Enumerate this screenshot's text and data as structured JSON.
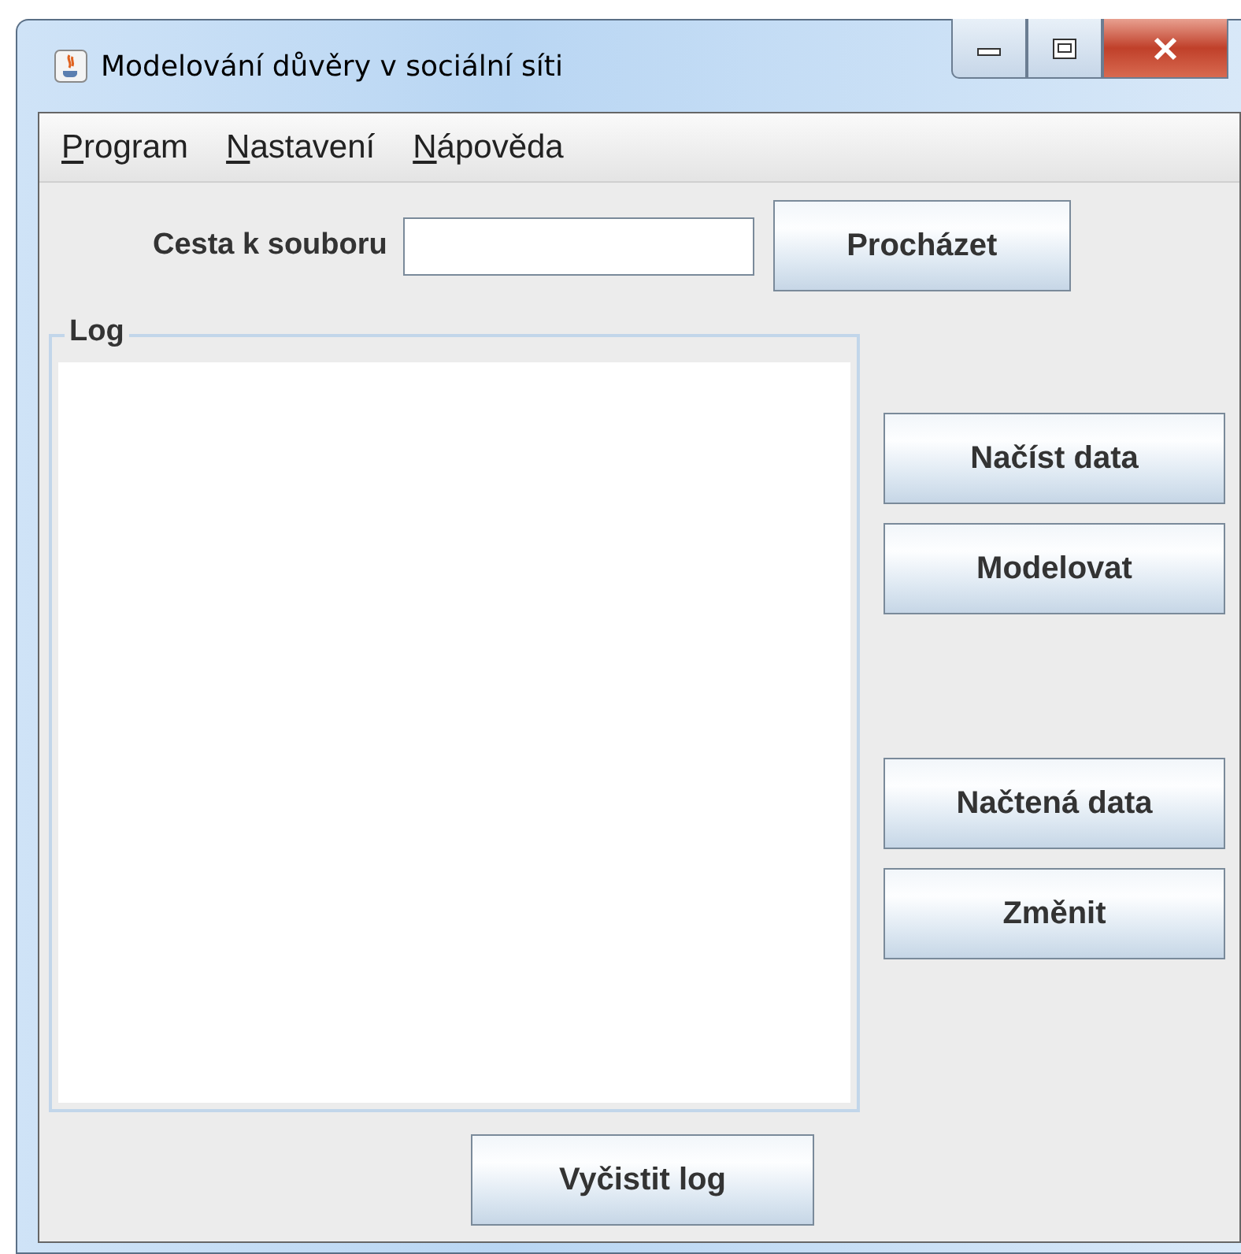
{
  "window": {
    "title": "Modelování důvěry v sociální síti"
  },
  "menu": [
    {
      "label": "Program",
      "underline_first": true
    },
    {
      "label": "Nastavení",
      "underline_first": true
    },
    {
      "label": "Nápověda",
      "underline_first": true
    }
  ],
  "path_field": {
    "label": "Cesta k souboru",
    "button": "Procházet"
  },
  "log": {
    "title": "Log"
  },
  "side_buttons": [
    {
      "label": "Načíst data",
      "kind": "button"
    },
    {
      "label": "Modelovat",
      "kind": "button"
    },
    {
      "kind": "spacer"
    },
    {
      "label": "Načtená data",
      "kind": "button"
    },
    {
      "label": "Změnit",
      "kind": "button"
    }
  ],
  "clear_button": {
    "label": "Vyčistit log"
  }
}
